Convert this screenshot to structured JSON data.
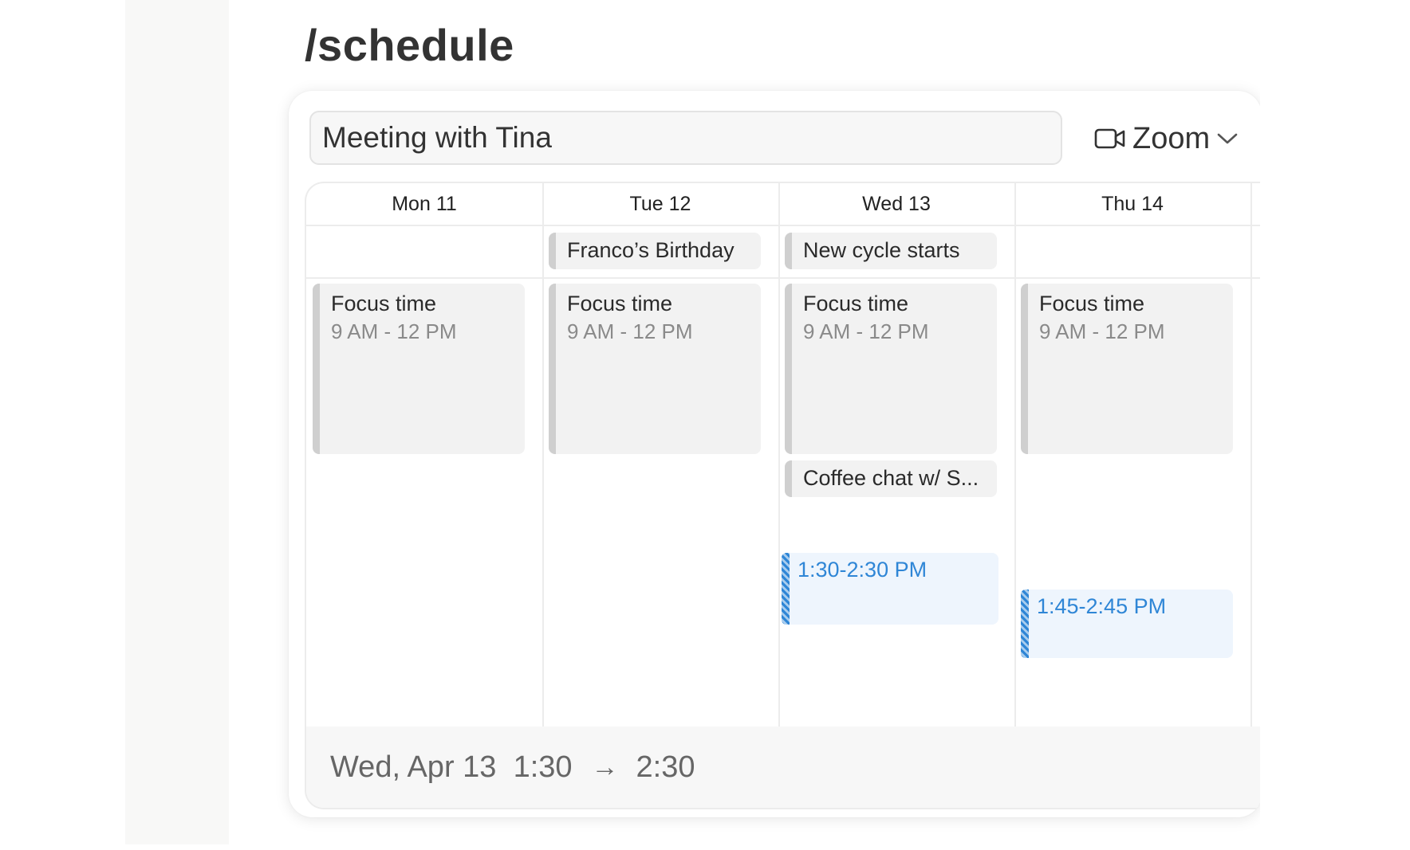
{
  "page": {
    "title": "/schedule"
  },
  "editor": {
    "event_title": "Meeting with Tina",
    "conferencing": {
      "icon": "video-camera-icon",
      "label": "Zoom"
    }
  },
  "calendar": {
    "days": [
      {
        "label": "Mon 11",
        "all_day": "",
        "events": [
          {
            "title": "Focus time",
            "time": "9 AM - 12 PM"
          }
        ]
      },
      {
        "label": "Tue 12",
        "all_day": "Franco’s Birthday",
        "events": [
          {
            "title": "Focus time",
            "time": "9 AM - 12 PM"
          }
        ]
      },
      {
        "label": "Wed 13",
        "all_day": "New cycle starts",
        "events": [
          {
            "title": "Focus time",
            "time": "9 AM - 12 PM"
          },
          {
            "title": "Coffee chat w/ S..."
          }
        ],
        "proposed": "1:30-2:30 PM"
      },
      {
        "label": "Thu 14",
        "all_day": "",
        "events": [
          {
            "title": "Focus time",
            "time": "9 AM - 12 PM"
          }
        ],
        "proposed": "1:45-2:45 PM"
      }
    ]
  },
  "summary": {
    "date": "Wed, Apr 13",
    "start": "1:30",
    "end": "2:30"
  },
  "colors": {
    "accent": "#2f86d6",
    "proposed_bg": "#eef5fd",
    "event_bg": "#f2f2f2"
  }
}
